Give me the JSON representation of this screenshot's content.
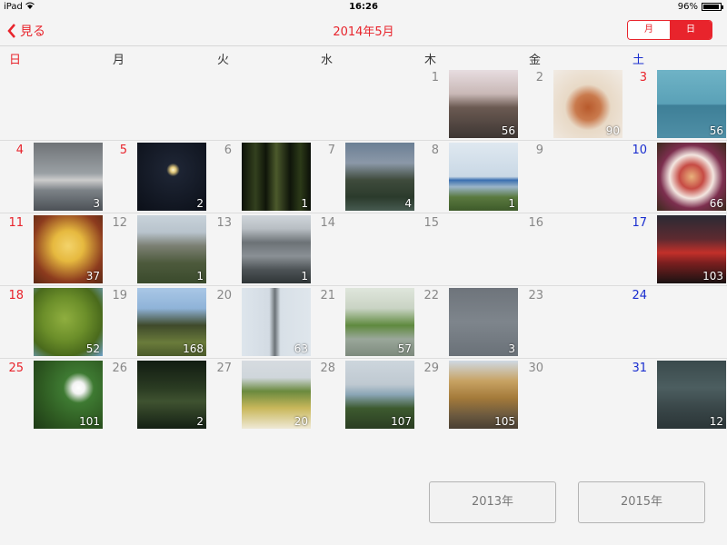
{
  "status": {
    "device": "iPad",
    "time": "16:26",
    "battery": "96%",
    "battery_level": 0.96
  },
  "nav": {
    "back_label": "見る",
    "title": "2014年5月",
    "seg_month": "月",
    "seg_day": "日"
  },
  "weekdays": [
    "日",
    "月",
    "火",
    "水",
    "木",
    "金",
    "土"
  ],
  "colors": {
    "accent": "#e8242c",
    "sunday": "#e8242c",
    "saturday": "#1a2ecf",
    "weekday": "#888888"
  },
  "cells": [
    {
      "day": "1",
      "count": "56",
      "thumb": "cherry-blossom-road"
    },
    {
      "day": "2",
      "count": "90",
      "thumb": "iced-tea"
    },
    {
      "day": "3",
      "count": "56",
      "thumb": "sea-horizon",
      "num_color": "sunday"
    },
    {
      "day": "4",
      "count": "3",
      "thumb": "shipwreck"
    },
    {
      "day": "5",
      "count": "2",
      "thumb": "night-moon",
      "num_color": "sunday"
    },
    {
      "day": "6",
      "count": "1",
      "thumb": "bamboo-night"
    },
    {
      "day": "7",
      "count": "4",
      "thumb": "trees-sky"
    },
    {
      "day": "8",
      "count": "1",
      "thumb": "blue-bridge"
    },
    {
      "day": "9",
      "count": "",
      "thumb": ""
    },
    {
      "day": "10",
      "count": "66",
      "thumb": "cake-plate"
    },
    {
      "day": "11",
      "count": "37",
      "thumb": "rice-bowl"
    },
    {
      "day": "12",
      "count": "1",
      "thumb": "town-view"
    },
    {
      "day": "13",
      "count": "1",
      "thumb": "roof-tiles"
    },
    {
      "day": "14",
      "count": "",
      "thumb": ""
    },
    {
      "day": "15",
      "count": "",
      "thumb": ""
    },
    {
      "day": "16",
      "count": "",
      "thumb": ""
    },
    {
      "day": "17",
      "count": "103",
      "thumb": "red-sunset"
    },
    {
      "day": "18",
      "count": "52",
      "thumb": "green-tree"
    },
    {
      "day": "19",
      "count": "168",
      "thumb": "temple"
    },
    {
      "day": "20",
      "count": "63",
      "thumb": "sky-tower"
    },
    {
      "day": "21",
      "count": "57",
      "thumb": "green-hill"
    },
    {
      "day": "22",
      "count": "3",
      "thumb": "grey-rainbow"
    },
    {
      "day": "23",
      "count": "",
      "thumb": ""
    },
    {
      "day": "24",
      "count": "",
      "thumb": ""
    },
    {
      "day": "25",
      "count": "101",
      "thumb": "white-flower"
    },
    {
      "day": "26",
      "count": "2",
      "thumb": "dark-shrub"
    },
    {
      "day": "27",
      "count": "20",
      "thumb": "flower-field"
    },
    {
      "day": "28",
      "count": "107",
      "thumb": "fountain"
    },
    {
      "day": "29",
      "count": "105",
      "thumb": "ginkgo-avenue"
    },
    {
      "day": "30",
      "count": "",
      "thumb": ""
    },
    {
      "day": "31",
      "count": "12",
      "thumb": "pond-ducks"
    }
  ],
  "buttons": {
    "prev_year": "2013年",
    "next_year": "2015年"
  }
}
